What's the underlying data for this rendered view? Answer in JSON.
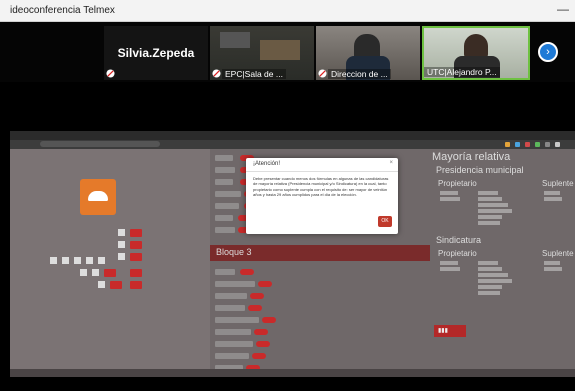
{
  "window": {
    "title": "ideoconferencia Telmex",
    "minimize_icon": "minimize-icon"
  },
  "participants": [
    {
      "name": "Silvia.Zepeda",
      "label": "",
      "muted": true
    },
    {
      "name": "",
      "label": "EPC|Sala de ...",
      "muted": true
    },
    {
      "name": "",
      "label": "Direccion de ...",
      "muted": true
    },
    {
      "name": "",
      "label": "UTC|Alejandro P...",
      "muted": false,
      "active": true
    }
  ],
  "next_button_icon": "chevron-right-icon",
  "shared_screen": {
    "right_panel": {
      "title": "Mayoría relativa",
      "section1": "Presidencia municipal",
      "col1": "Propietario",
      "col2": "Suplente",
      "section2": "Sindicatura",
      "col3": "Propietario",
      "col4": "Suplente"
    },
    "bloque": "Bloque 3",
    "modal": {
      "title": "¡Atención!",
      "close": "×",
      "body": "Debe presentar cuando menos dos fórmulas en algunas de las candidaturas de mayoría relativa (Presidencia municipal y/o Sindicatura) en la cual, tanto propietario como suplente cumpla con el requisito de: ser mayor de veintiún años y hasta 29 años cumplidos para el día de la elección.",
      "ok": "OK"
    }
  },
  "colors": {
    "accent_red": "#c92a2a",
    "active_border": "#6ec141",
    "next_button": "#1e7ad6"
  }
}
